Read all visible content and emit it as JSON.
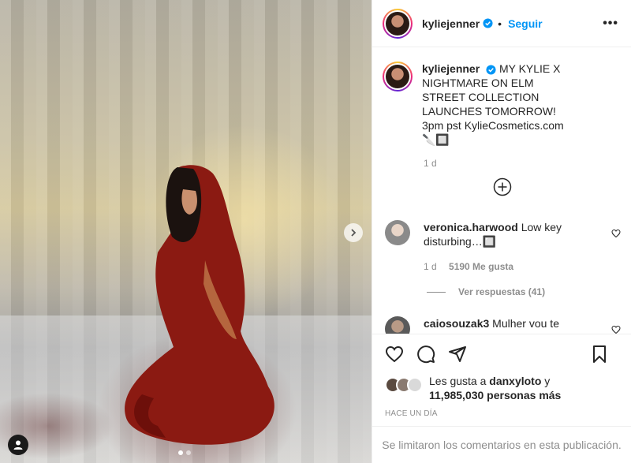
{
  "post": {
    "author": "kyliejenner",
    "follow_label": "Seguir",
    "bullet": "•",
    "more_label": "•••",
    "caption_text": "MY KYLIE X NIGHTMARE ON ELM STREET COLLECTION LAUNCHES TOMORROW! 3pm pst KylieCosmetics.com 🔪🔲",
    "caption_time": "1 d"
  },
  "comments": [
    {
      "user": "veronica.harwood",
      "text": "Low key disturbing…🔲",
      "time": "1 d",
      "likes": "5190 Me gusta"
    },
    {
      "user": "caiosouzak3",
      "text": "Mulher vou te"
    }
  ],
  "replies_label": "Ver respuestas (41)",
  "likes": {
    "prefix": "Les gusta a",
    "user": "danxyloto",
    "connector": "y",
    "count": "11,985,030 personas más"
  },
  "timestamp": "Hace un día",
  "comments_limited": "Se limitaron los comentarios en esta publicación.",
  "carousel": {
    "current": 1,
    "total": 2
  },
  "colors": {
    "accent": "#0095f6",
    "muted": "#8e8e8e",
    "text": "#262626"
  }
}
